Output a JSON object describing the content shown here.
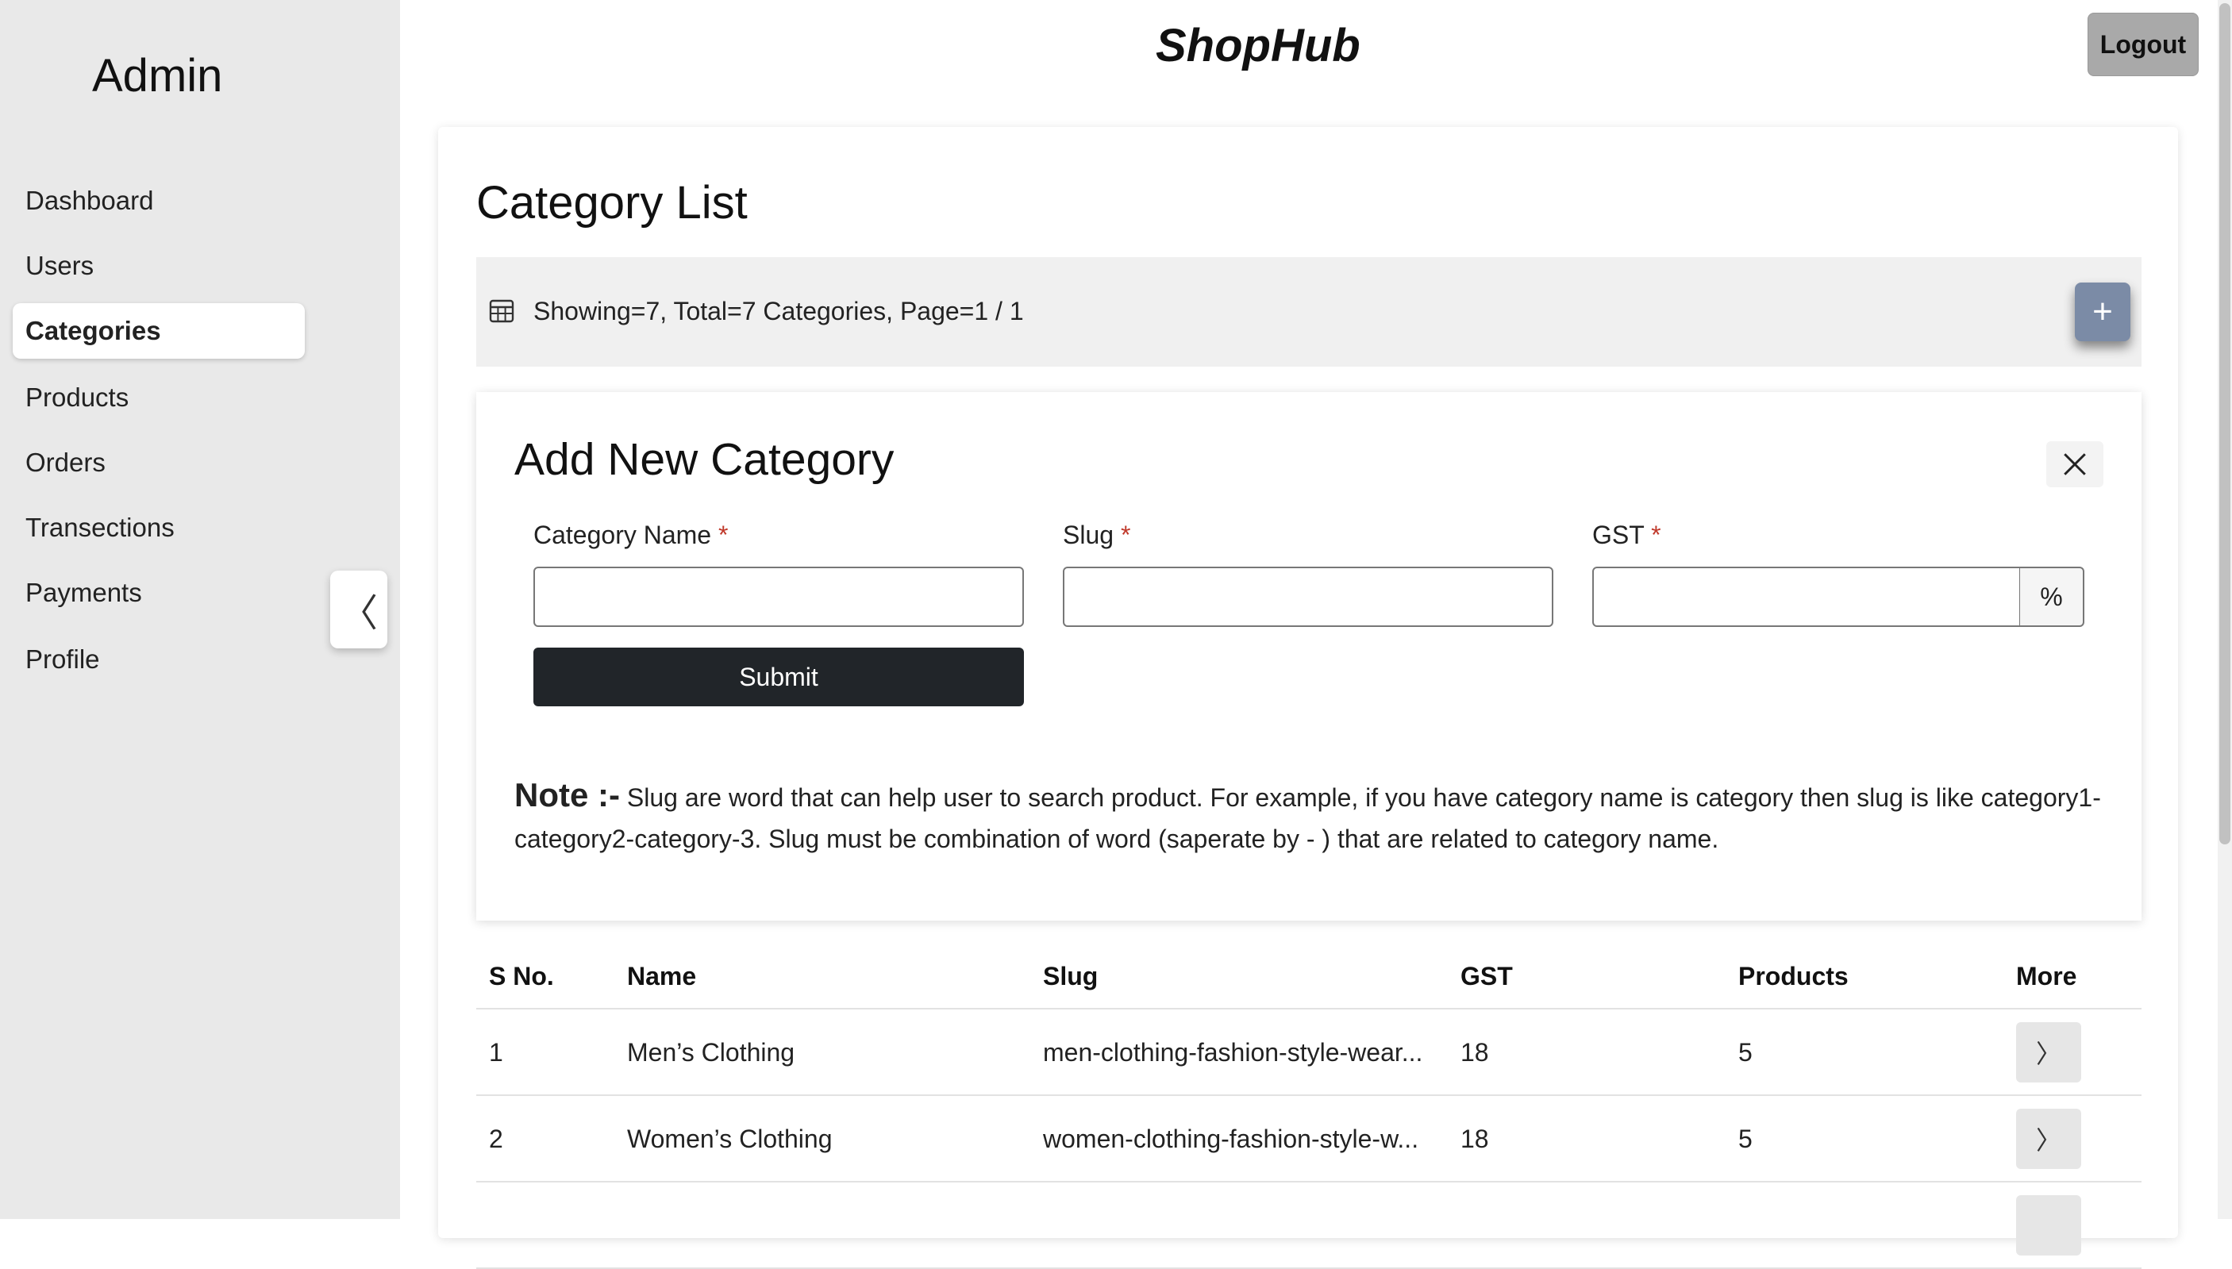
{
  "sidebar": {
    "title": "Admin",
    "items": [
      {
        "label": "Dashboard"
      },
      {
        "label": "Users"
      },
      {
        "label": "Categories"
      },
      {
        "label": "Products"
      },
      {
        "label": "Orders"
      },
      {
        "label": "Transections"
      },
      {
        "label": "Payments"
      },
      {
        "label": "Profile"
      }
    ],
    "active": "Categories",
    "collapse_icon": "chevron-left-icon",
    "collapse_glyph": "〈"
  },
  "header": {
    "brand": "ShopHub",
    "logout_label": "Logout"
  },
  "page": {
    "title": "Category List",
    "info_text": "Showing=7, Total=7 Categories, Page=1 / 1",
    "add_glyph": "+"
  },
  "form": {
    "title": "Add New Category",
    "fields": [
      {
        "label": "Category Name",
        "required": "*",
        "value": "",
        "placeholder": ""
      },
      {
        "label": "Slug",
        "required": "*",
        "value": "",
        "placeholder": ""
      },
      {
        "label": "GST",
        "required": "*",
        "value": "",
        "placeholder": ""
      }
    ],
    "gst_suffix": "%",
    "submit_label": "Submit",
    "note_label": "Note :-",
    "note_text": "Slug are word that can help user to search product. For example, if you have category name is category then slug is like category1-category2-category-3. Slug must be combination of word (saperate by - ) that are related to category name."
  },
  "table": {
    "headers": [
      "S No.",
      "Name",
      "Slug",
      "GST",
      "Products",
      "More"
    ],
    "rows": [
      {
        "sno": "1",
        "name": "Men’s Clothing",
        "slug": "men-clothing-fashion-style-wear...",
        "gst": "18",
        "products": "5",
        "more": "〉"
      },
      {
        "sno": "2",
        "name": "Women’s Clothing",
        "slug": "women-clothing-fashion-style-w...",
        "gst": "18",
        "products": "5",
        "more": "〉"
      }
    ]
  },
  "colors": {
    "sidebar_bg": "#e9e9e9",
    "submit_bg": "#212529",
    "add_button_bg": "#7b8ba6",
    "logout_bg": "#a9a9a9",
    "required_mark": "#c0392b"
  }
}
